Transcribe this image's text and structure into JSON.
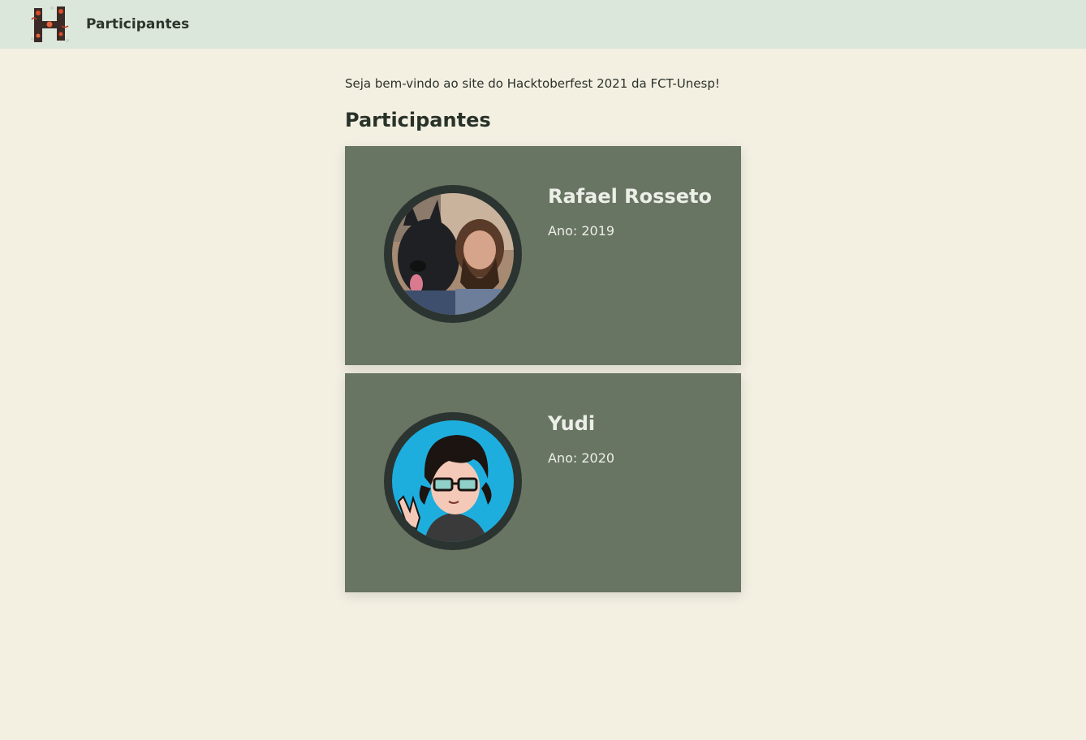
{
  "navbar": {
    "logo_icon": "hacktoberfest-h-logo-icon",
    "title": "Participantes"
  },
  "main": {
    "welcome": "Seja bem-vindo ao site do Hacktoberfest 2021 da FCT-Unesp!",
    "heading": "Participantes"
  },
  "participants": [
    {
      "name": "Rafael Rosseto",
      "year_label": "Ano: 2019",
      "avatar_icon": "photo-avatar-with-dog"
    },
    {
      "name": "Yudi",
      "year_label": "Ano: 2020",
      "avatar_icon": "cartoon-avatar-with-glasses"
    }
  ],
  "colors": {
    "page_background": "#f3f0e2",
    "navbar_background": "#dce7db",
    "card_background": "#697563",
    "avatar_ring": "#2b3430",
    "card_text": "#eceee8"
  }
}
